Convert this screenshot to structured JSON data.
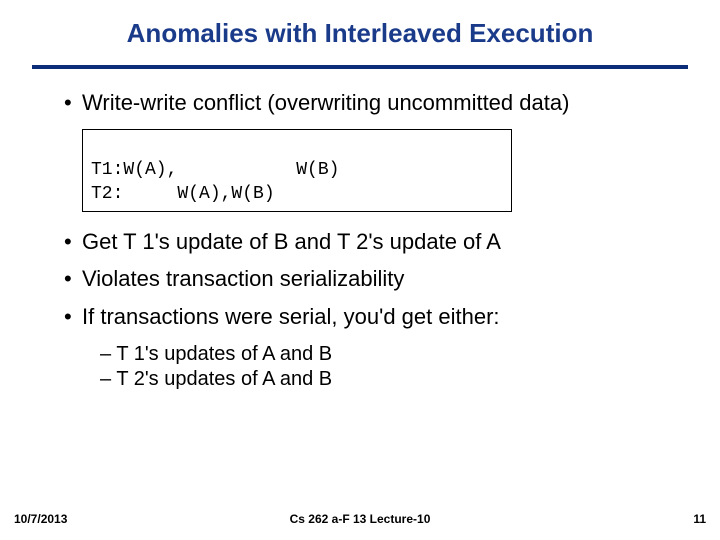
{
  "title": "Anomalies with Interleaved Execution",
  "bullets": {
    "b1": "Write-write conflict (overwriting uncommitted data)",
    "b2": "Get T 1's update of B and T 2's update of A",
    "b3": "Violates transaction serializability",
    "b4": "If transactions were serial, you'd get either:"
  },
  "code": {
    "line1": "T1:W(A),           W(B)",
    "line2": "T2:     W(A),W(B)"
  },
  "sub": {
    "s1": "– T 1's updates of A and B",
    "s2": "– T 2's updates of A and B"
  },
  "footer": {
    "date": "10/7/2013",
    "center": "Cs 262 a-F 13 Lecture-10",
    "page": "11"
  }
}
